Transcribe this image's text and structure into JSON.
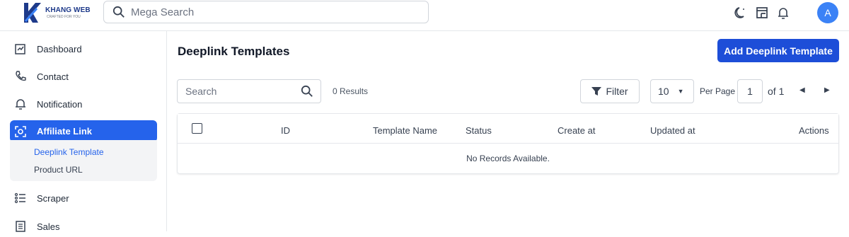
{
  "brand": {
    "name": "KHANG WEB",
    "tagline": "CRAFTED FOR YOU"
  },
  "topbar": {
    "search_placeholder": "Mega Search",
    "avatar_initial": "A"
  },
  "sidebar": {
    "items": [
      {
        "label": "Dashboard",
        "icon": "dashboard-icon"
      },
      {
        "label": "Contact",
        "icon": "phone-icon"
      },
      {
        "label": "Notification",
        "icon": "bell-icon"
      },
      {
        "label": "Affiliate Link",
        "icon": "affiliate-icon",
        "active": true
      },
      {
        "label": "Scraper",
        "icon": "list-icon"
      },
      {
        "label": "Sales",
        "icon": "document-icon"
      }
    ],
    "submenu": [
      {
        "label": "Deeplink Template",
        "active": true
      },
      {
        "label": "Product URL"
      }
    ]
  },
  "main": {
    "title": "Deeplink Templates",
    "add_button": "Add Deeplink Template",
    "search_placeholder": "Search",
    "results": "0 Results",
    "filter_label": "Filter",
    "per_page_value": "10",
    "per_page_label": "Per Page",
    "page_current": "1",
    "page_of": "of 1"
  },
  "table": {
    "columns": [
      "ID",
      "Template Name",
      "Status",
      "Create at",
      "Updated at",
      "Actions"
    ],
    "empty_text": "No Records Available."
  },
  "colors": {
    "primary": "#2563eb",
    "button": "#1d4ed8",
    "avatar": "#3b82f6"
  }
}
